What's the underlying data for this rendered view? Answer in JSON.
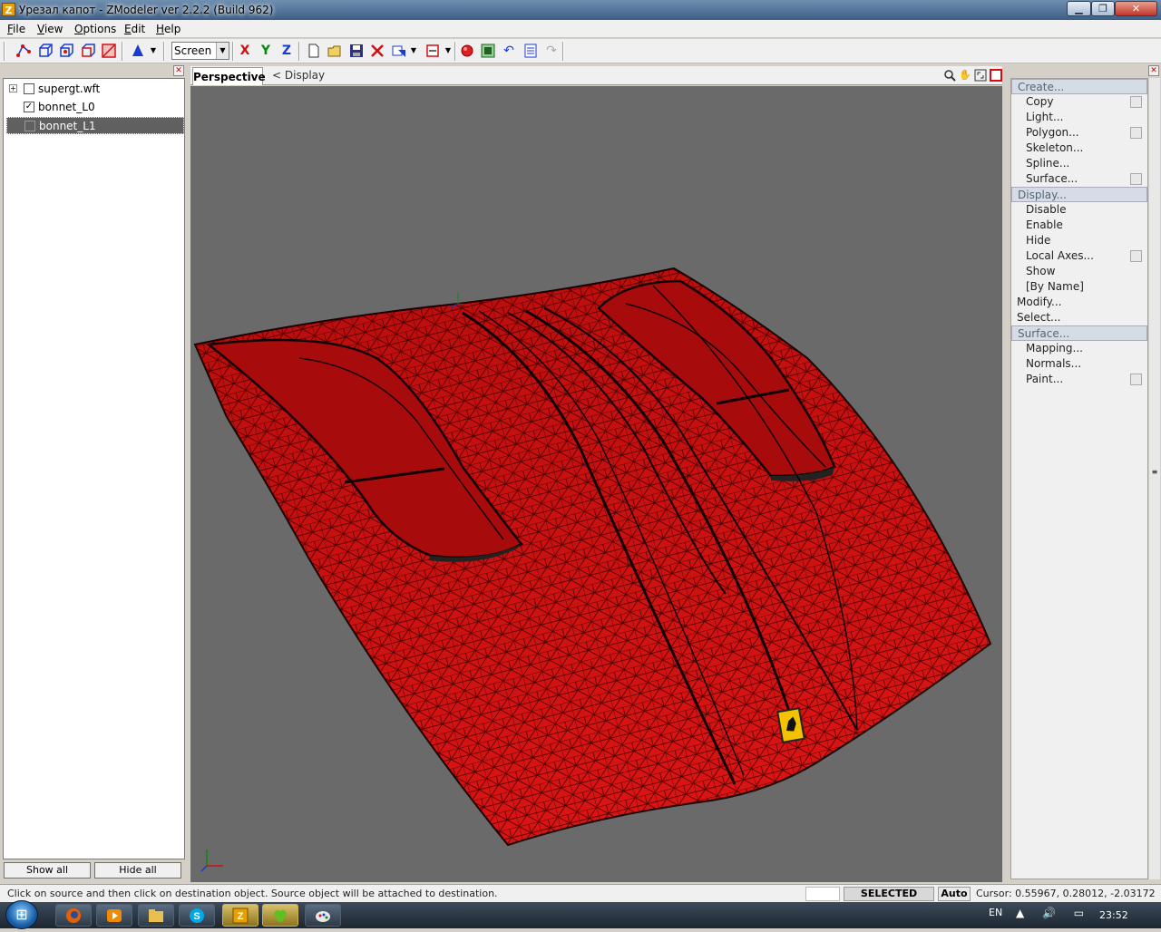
{
  "window": {
    "title": "Урезал капот - ZModeler ver 2.2.2 (Build 962)",
    "logo_letter": "Z",
    "controls": {
      "minimize": "▁",
      "maximize": "❐",
      "close": "✕"
    }
  },
  "menu": {
    "items": [
      {
        "u": "F",
        "rest": "ile"
      },
      {
        "u": "V",
        "rest": "iew"
      },
      {
        "u": "O",
        "rest": "ptions"
      },
      {
        "u": "E",
        "rest": "dit"
      },
      {
        "u": "H",
        "rest": "elp"
      }
    ]
  },
  "toolbar": {
    "screen_select": "Screen",
    "axis_x": "X",
    "axis_y": "Y",
    "axis_z": "Z",
    "colors": {
      "x": "#d01010",
      "y": "#0a8a0a",
      "z": "#1a3ad0"
    }
  },
  "left_panel": {
    "close": "✕",
    "tree": [
      {
        "label": "supergt.wft",
        "expander": "+",
        "checked": "",
        "selected": false
      },
      {
        "label": "bonnet_L0",
        "expander": "",
        "checked": "✓",
        "selected": false
      },
      {
        "label": "bonnet_L1",
        "expander": "",
        "checked": "",
        "selected": true
      }
    ],
    "show_all": "Show all",
    "hide_all": "Hide all"
  },
  "viewport": {
    "tab_active": "Perspective",
    "tab_display": "<  Display",
    "icons": [
      "zoom-icon",
      "pan-hand-icon",
      "maximize-view-icon",
      "close-view-icon"
    ],
    "mesh_color": "#c40f0f",
    "background": "#6a6a6a"
  },
  "right_panel": {
    "close": "✕",
    "items": [
      {
        "type": "hdr",
        "label": "Create...",
        "opt": false
      },
      {
        "type": "sub",
        "label": "Copy",
        "opt": true
      },
      {
        "type": "sub",
        "label": "Light...",
        "opt": false
      },
      {
        "type": "sub",
        "label": "Polygon...",
        "opt": true
      },
      {
        "type": "sub",
        "label": "Skeleton...",
        "opt": false
      },
      {
        "type": "sub",
        "label": "Spline...",
        "opt": false
      },
      {
        "type": "sub",
        "label": "Surface...",
        "opt": true
      },
      {
        "type": "hdr",
        "label": "Display...",
        "opt": false
      },
      {
        "type": "sub",
        "label": "Disable",
        "opt": false
      },
      {
        "type": "sub",
        "label": "Enable",
        "opt": false
      },
      {
        "type": "sub",
        "label": "Hide",
        "opt": false
      },
      {
        "type": "sub",
        "label": "Local Axes...",
        "opt": true
      },
      {
        "type": "sub",
        "label": "Show",
        "opt": false
      },
      {
        "type": "sub",
        "label": "[By Name]",
        "opt": false
      },
      {
        "type": "top",
        "label": "Modify...",
        "opt": false
      },
      {
        "type": "top",
        "label": "Select...",
        "opt": false
      },
      {
        "type": "hdr",
        "label": "Surface...",
        "opt": false
      },
      {
        "type": "sub",
        "label": "Mapping...",
        "opt": false
      },
      {
        "type": "sub",
        "label": "Normals...",
        "opt": false
      },
      {
        "type": "sub",
        "label": "Paint...",
        "opt": true
      }
    ]
  },
  "status": {
    "message": "Click on source and then click on destination object. Source object will be attached to destination.",
    "mode": "SELECTED MODE",
    "auto": "Auto",
    "cursor": "Cursor: 0.55967, 0.28012, -2.03172"
  },
  "taskbar": {
    "lang": "EN",
    "tray": "▲ 🔊 ▭",
    "clock": "23:52",
    "apps": [
      "firefox-icon",
      "media-player-icon",
      "explorer-icon",
      "skype-icon",
      "zmodeler-icon",
      "app-icon",
      "paint-icon"
    ]
  }
}
